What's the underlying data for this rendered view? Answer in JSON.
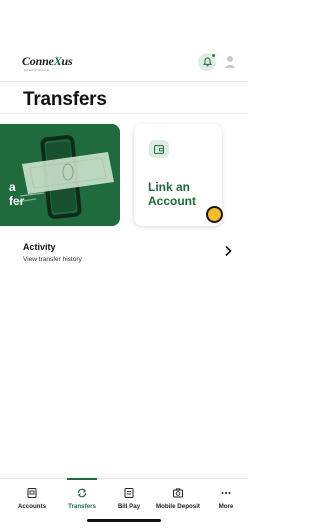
{
  "header": {
    "logo_text_pre": "Conne",
    "logo_text_x": "X",
    "logo_text_post": "us",
    "logo_subtext": "CREDIT UNION",
    "bell_icon": "bell-icon",
    "profile_icon": "person-icon"
  },
  "page": {
    "title": "Transfers"
  },
  "cards": {
    "transfer": {
      "label_line1": "a",
      "label_line2": "fer"
    },
    "link": {
      "label_line1": "Link an",
      "label_line2": "Account",
      "icon": "wallet-icon"
    }
  },
  "activity": {
    "title": "Activity",
    "subtitle": "View transfer history",
    "chevron_icon": "chevron-right-icon"
  },
  "tabbar": {
    "items": [
      {
        "label": "Accounts",
        "icon": "accounts-icon",
        "active": false
      },
      {
        "label": "Transfers",
        "icon": "transfer-arrows-icon",
        "active": true
      },
      {
        "label": "Bill Pay",
        "icon": "bill-pay-icon",
        "active": false
      },
      {
        "label": "Mobile Deposit",
        "icon": "camera-icon",
        "active": false
      },
      {
        "label": "More",
        "icon": "more-dots-icon",
        "active": false
      }
    ]
  },
  "colors": {
    "brand_green": "#1f6b3d",
    "light_green": "#dceee2",
    "accent_yellow": "#f5bd2a"
  }
}
